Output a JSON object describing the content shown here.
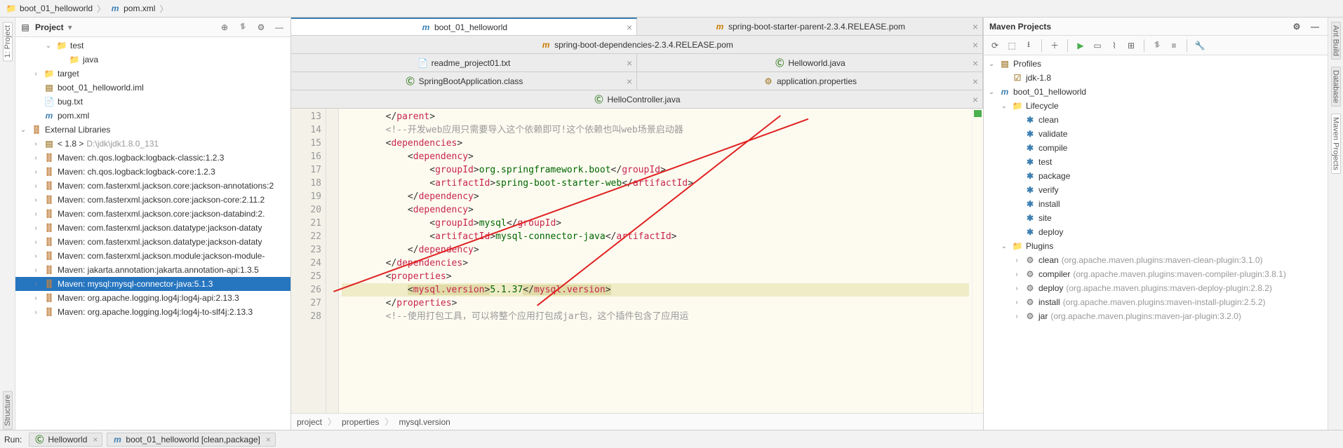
{
  "breadcrumb": {
    "root": "boot_01_helloworld",
    "file": "pom.xml"
  },
  "project_panel": {
    "title": "Project",
    "tree": [
      {
        "lvl": 2,
        "arrow": "v",
        "icon": "folder",
        "label": "test"
      },
      {
        "lvl": 3,
        "arrow": "",
        "icon": "folder-src",
        "label": "java"
      },
      {
        "lvl": 1,
        "arrow": ">",
        "icon": "folder-target",
        "label": "target"
      },
      {
        "lvl": 1,
        "arrow": "",
        "icon": "iml",
        "label": "boot_01_helloworld.iml"
      },
      {
        "lvl": 1,
        "arrow": "",
        "icon": "txt",
        "label": "bug.txt"
      },
      {
        "lvl": 1,
        "arrow": "",
        "icon": "maven",
        "label": "pom.xml"
      },
      {
        "lvl": 0,
        "arrow": "v",
        "icon": "lib",
        "label": "External Libraries"
      },
      {
        "lvl": 1,
        "arrow": ">",
        "icon": "jdk",
        "label": "< 1.8 >",
        "extra": " D:\\jdk\\jdk1.8.0_131"
      },
      {
        "lvl": 1,
        "arrow": ">",
        "icon": "lib",
        "label": "Maven: ch.qos.logback:logback-classic:1.2.3"
      },
      {
        "lvl": 1,
        "arrow": ">",
        "icon": "lib",
        "label": "Maven: ch.qos.logback:logback-core:1.2.3"
      },
      {
        "lvl": 1,
        "arrow": ">",
        "icon": "lib",
        "label": "Maven: com.fasterxml.jackson.core:jackson-annotations:2"
      },
      {
        "lvl": 1,
        "arrow": ">",
        "icon": "lib",
        "label": "Maven: com.fasterxml.jackson.core:jackson-core:2.11.2"
      },
      {
        "lvl": 1,
        "arrow": ">",
        "icon": "lib",
        "label": "Maven: com.fasterxml.jackson.core:jackson-databind:2."
      },
      {
        "lvl": 1,
        "arrow": ">",
        "icon": "lib",
        "label": "Maven: com.fasterxml.jackson.datatype:jackson-dataty"
      },
      {
        "lvl": 1,
        "arrow": ">",
        "icon": "lib",
        "label": "Maven: com.fasterxml.jackson.datatype:jackson-dataty"
      },
      {
        "lvl": 1,
        "arrow": ">",
        "icon": "lib",
        "label": "Maven: com.fasterxml.jackson.module:jackson-module-"
      },
      {
        "lvl": 1,
        "arrow": ">",
        "icon": "lib",
        "label": "Maven: jakarta.annotation:jakarta.annotation-api:1.3.5"
      },
      {
        "lvl": 1,
        "arrow": ">",
        "icon": "lib",
        "label": "Maven: mysql:mysql-connector-java:5.1.3",
        "sel": true
      },
      {
        "lvl": 1,
        "arrow": ">",
        "icon": "lib",
        "label": "Maven: org.apache.logging.log4j:log4j-api:2.13.3"
      },
      {
        "lvl": 1,
        "arrow": ">",
        "icon": "lib",
        "label": "Maven: org.apache.logging.log4j:log4j-to-slf4j:2.13.3"
      }
    ]
  },
  "editor_tabs": {
    "row1": [
      {
        "icon": "maven",
        "label": "boot_01_helloworld",
        "active": true
      },
      {
        "icon": "pom",
        "label": "spring-boot-starter-parent-2.3.4.RELEASE.pom"
      }
    ],
    "row2": [
      {
        "icon": "pom",
        "label": "spring-boot-dependencies-2.3.4.RELEASE.pom"
      }
    ],
    "row3": [
      {
        "icon": "txt",
        "label": "readme_project01.txt"
      },
      {
        "icon": "java",
        "label": "Helloworld.java"
      }
    ],
    "row4": [
      {
        "icon": "class",
        "label": "SpringBootApplication.class"
      },
      {
        "icon": "prop",
        "label": "application.properties"
      }
    ],
    "row5": [
      {
        "icon": "java",
        "label": "HelloController.java"
      }
    ]
  },
  "code": {
    "start": 13,
    "lines": [
      {
        "html": "        &lt;/<span class='tag'>parent</span>&gt;"
      },
      {
        "html": "        <span class='cm'>&lt;!--开发web应用只需要导入这个依赖即可!这个依赖也叫web场景启动器</span>"
      },
      {
        "html": "        &lt;<span class='tag'>dependencies</span>&gt;"
      },
      {
        "html": "            &lt;<span class='tag'>dependency</span>&gt;"
      },
      {
        "html": "                &lt;<span class='tag'>groupId</span>&gt;<span class='val'>org.springframework.boot</span>&lt;/<span class='tag'>groupId</span>&gt;"
      },
      {
        "html": "                &lt;<span class='tag'>artifactId</span>&gt;<span class='val'>spring-boot-starter-web</span>&lt;/<span class='tag'>artifactId</span>&gt;"
      },
      {
        "html": "            &lt;/<span class='tag'>dependency</span>&gt;"
      },
      {
        "html": "            &lt;<span class='tag'>dependency</span>&gt;"
      },
      {
        "html": "                &lt;<span class='tag'>groupId</span>&gt;<span class='val'>mysql</span>&lt;/<span class='tag'>groupId</span>&gt;"
      },
      {
        "html": "                &lt;<span class='tag'>artifactId</span>&gt;<span class='val'>mysql-connector-java</span>&lt;/<span class='tag'>artifactId</span>&gt;"
      },
      {
        "html": "            &lt;/<span class='tag'>dependency</span>&gt;"
      },
      {
        "html": "        &lt;/<span class='tag'>dependencies</span>&gt;"
      },
      {
        "html": "        &lt;<span class='tag'>properties</span>&gt;"
      },
      {
        "html": "            <span class='hl'>&lt;<span class='tag'>mysql.version</span>&gt;</span><span class='val'>5.1.37</span><span class='hl'>&lt;/<span class='tag'>mysql.version</span>&gt;</span>",
        "hl": true
      },
      {
        "html": "        &lt;/<span class='tag'>properties</span>&gt;"
      },
      {
        "html": "        <span class='cm'>&lt;!--使用打包工具，可以将整个应用打包成jar包，这个插件包含了应用运</span>"
      }
    ],
    "crumb": [
      "project",
      "properties",
      "mysql.version"
    ]
  },
  "maven": {
    "title": "Maven Projects",
    "tree": [
      {
        "lvl": 0,
        "arrow": "v",
        "icon": "profiles",
        "label": "Profiles"
      },
      {
        "lvl": 1,
        "arrow": "",
        "icon": "check",
        "label": "jdk-1.8"
      },
      {
        "lvl": 0,
        "arrow": "v",
        "icon": "maven",
        "label": "boot_01_helloworld"
      },
      {
        "lvl": 1,
        "arrow": "v",
        "icon": "folder",
        "label": "Lifecycle"
      },
      {
        "lvl": 2,
        "arrow": "",
        "icon": "gear",
        "label": "clean"
      },
      {
        "lvl": 2,
        "arrow": "",
        "icon": "gear",
        "label": "validate"
      },
      {
        "lvl": 2,
        "arrow": "",
        "icon": "gear",
        "label": "compile"
      },
      {
        "lvl": 2,
        "arrow": "",
        "icon": "gear",
        "label": "test"
      },
      {
        "lvl": 2,
        "arrow": "",
        "icon": "gear",
        "label": "package"
      },
      {
        "lvl": 2,
        "arrow": "",
        "icon": "gear",
        "label": "verify"
      },
      {
        "lvl": 2,
        "arrow": "",
        "icon": "gear",
        "label": "install"
      },
      {
        "lvl": 2,
        "arrow": "",
        "icon": "gear",
        "label": "site"
      },
      {
        "lvl": 2,
        "arrow": "",
        "icon": "gear",
        "label": "deploy"
      },
      {
        "lvl": 1,
        "arrow": "v",
        "icon": "folder",
        "label": "Plugins"
      },
      {
        "lvl": 2,
        "arrow": ">",
        "icon": "plug",
        "label": "clean",
        "extra": " (org.apache.maven.plugins:maven-clean-plugin:3.1.0)"
      },
      {
        "lvl": 2,
        "arrow": ">",
        "icon": "plug",
        "label": "compiler",
        "extra": " (org.apache.maven.plugins:maven-compiler-plugin:3.8.1)"
      },
      {
        "lvl": 2,
        "arrow": ">",
        "icon": "plug",
        "label": "deploy",
        "extra": " (org.apache.maven.plugins:maven-deploy-plugin:2.8.2)"
      },
      {
        "lvl": 2,
        "arrow": ">",
        "icon": "plug",
        "label": "install",
        "extra": " (org.apache.maven.plugins:maven-install-plugin:2.5.2)"
      },
      {
        "lvl": 2,
        "arrow": ">",
        "icon": "plug",
        "label": "jar",
        "extra": " (org.apache.maven.plugins:maven-jar-plugin:3.2.0)"
      }
    ]
  },
  "bottom": {
    "run": "Run:",
    "tabs": [
      {
        "icon": "java",
        "label": "Helloworld"
      },
      {
        "icon": "maven",
        "label": "boot_01_helloworld [clean,package]"
      }
    ]
  },
  "left_rail": [
    "1: Project",
    "Structure"
  ],
  "right_rail": [
    "Ant Build",
    "Database",
    "Maven Projects"
  ]
}
